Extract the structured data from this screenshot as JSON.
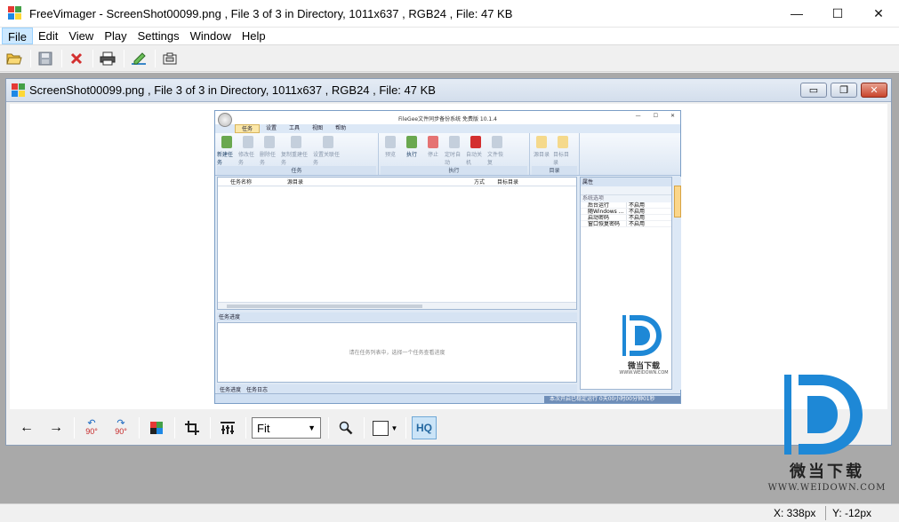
{
  "window": {
    "title": "FreeVimager - ScreenShot00099.png , File 3 of 3 in Directory, 1011x637 , RGB24 , File: 47 KB",
    "controls": {
      "minimize": "—",
      "maximize": "☐",
      "close": "✕"
    }
  },
  "menu": [
    "File",
    "Edit",
    "View",
    "Play",
    "Settings",
    "Window",
    "Help"
  ],
  "menu_active": "File",
  "toolbar": {
    "icons": [
      "open-folder-icon",
      "save-icon",
      "delete-icon",
      "print-icon",
      "edit-icon",
      "capture-icon"
    ]
  },
  "child_window": {
    "title": "ScreenShot00099.png , File 3 of 3 in Directory, 1011x637 , RGB24 , File: 47 KB",
    "controls": {
      "minimize": "▭",
      "restore": "❐",
      "close": "✕"
    }
  },
  "image_toolbar": {
    "prev": "←",
    "next": "→",
    "rotate_ccw": "90°",
    "rotate_cw": "90°",
    "zoom_value": "Fit",
    "hq_label": "HQ"
  },
  "status": {
    "x": "X: 338px",
    "y": "Y: -12px"
  },
  "screenshot": {
    "title": "FileGee文件同步备份系统 免费版 10.1.4",
    "tabs": [
      "任务",
      "设置",
      "工具",
      "视图",
      "帮助"
    ],
    "active_tab": "任务",
    "groups": [
      {
        "label": "任务",
        "items": [
          "新建任务",
          "修改任务",
          "删除任务",
          "复制重建任务",
          "设置关联任务"
        ]
      },
      {
        "label": "执行",
        "items": [
          "预览",
          "执行",
          "停止",
          "定时自动",
          "自动关机",
          "文件恢复"
        ]
      },
      {
        "label": "目录",
        "items": [
          "源目录",
          "目标目录"
        ]
      }
    ],
    "list_headers": [
      "任务名称",
      "源目录",
      "方式",
      "目标目录"
    ],
    "progress_title": "任务进度",
    "progress_hint": "请在任务列表中，选择一个任务查看进度",
    "bottom_tabs": [
      "任务进度",
      "任务日志"
    ],
    "props_title": "属性",
    "props_category": "系统选项",
    "props_rows": [
      {
        "name": "后台运行",
        "value": "不启用"
      },
      {
        "name": "随Windows ...",
        "value": "不启用"
      },
      {
        "name": "启动密码",
        "value": "不启用"
      },
      {
        "name": "窗口恢复密码",
        "value": "不启用"
      }
    ],
    "side_tab": "任务管理",
    "status_text": "本次开启已稳定运行 0天00小时00分钟01秒",
    "watermark": {
      "name": "微当下载",
      "url": "WWW.WEIDOWN.COM"
    }
  },
  "watermark": {
    "name": "微当下载",
    "url": "WWW.WEIDOWN.COM"
  },
  "colors": {
    "accent": "#1e88d6",
    "hq_active": "#cbe4f7",
    "mdi_background": "#a9a9a9"
  }
}
